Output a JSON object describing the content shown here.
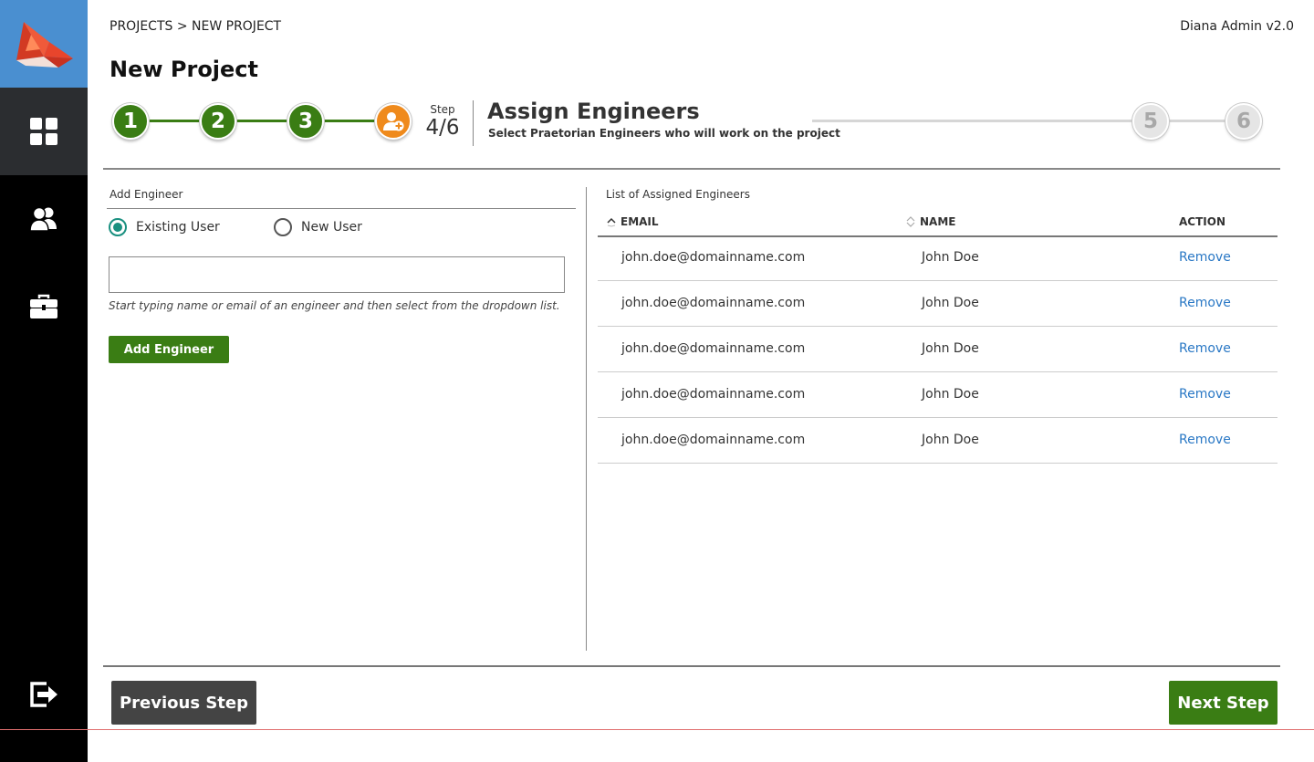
{
  "header": {
    "breadcrumb": "PROJECTS > NEW PROJECT",
    "app_version": "Diana Admin v2.0",
    "page_title": "New Project"
  },
  "sidebar": {
    "items": [
      {
        "icon": "dashboard-icon",
        "active": true
      },
      {
        "icon": "users-icon",
        "active": false
      },
      {
        "icon": "briefcase-icon",
        "active": false
      },
      {
        "icon": "logout-icon",
        "active": false
      }
    ]
  },
  "stepper": {
    "steps": [
      {
        "label": "1",
        "status": "done"
      },
      {
        "label": "2",
        "status": "done"
      },
      {
        "label": "3",
        "status": "done"
      },
      {
        "label": "",
        "icon": "add-user-icon",
        "status": "current"
      },
      {
        "label": "5",
        "status": "future"
      },
      {
        "label": "6",
        "status": "future"
      }
    ],
    "step_word": "Step",
    "step_count": "4/6",
    "current_title": "Assign Engineers",
    "current_desc": "Select Praetorian Engineers who will work on the project"
  },
  "add_engineer": {
    "section_label": "Add Engineer",
    "radio_existing": "Existing User",
    "radio_new": "New User",
    "selected": "existing",
    "input_value": "",
    "input_placeholder": "",
    "hint": "Start typing name or email of an engineer and then select from the dropdown list.",
    "add_button": "Add  Engineer"
  },
  "assigned": {
    "section_label": "List of Assigned Engineers",
    "columns": {
      "email": "EMAIL",
      "name": "NAME",
      "action": "ACTION"
    },
    "rows": [
      {
        "email": "john.doe@domainname.com",
        "name": "John Doe",
        "action": "Remove"
      },
      {
        "email": "john.doe@domainname.com",
        "name": "John Doe",
        "action": "Remove"
      },
      {
        "email": "john.doe@domainname.com",
        "name": "John Doe",
        "action": "Remove"
      },
      {
        "email": "john.doe@domainname.com",
        "name": "John Doe",
        "action": "Remove"
      },
      {
        "email": "john.doe@domainname.com",
        "name": "John Doe",
        "action": "Remove"
      }
    ]
  },
  "footer": {
    "prev_label": "Previous Step",
    "next_label": "Next Step"
  },
  "colors": {
    "accent_green": "#3a7d14",
    "current_orange": "#ef8a1c",
    "link_blue": "#2a78c5",
    "radio_teal": "#1a9080"
  }
}
